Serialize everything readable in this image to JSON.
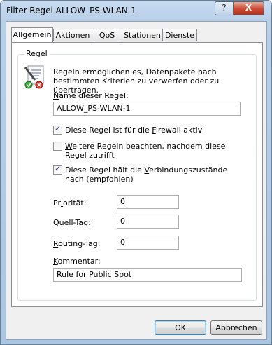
{
  "window": {
    "title": "Filter-Regel ALLOW_PS-WLAN-1",
    "help_label": "?",
    "close_label": "X"
  },
  "tabs": [
    {
      "label": "Allgemein"
    },
    {
      "label": "Aktionen"
    },
    {
      "label": "QoS"
    },
    {
      "label": "Stationen"
    },
    {
      "label": "Dienste"
    }
  ],
  "group": {
    "label": "Regel"
  },
  "description": "Regeln ermöglichen es, Datenpakete nach bestimmten Kriterien zu verwerfen oder zu übertragen.",
  "fields": {
    "rule_name": {
      "label_u": "N",
      "label_rest": "ame dieser Regel:",
      "value": "ALLOW_PS-WLAN-1"
    },
    "priority": {
      "label_u": "",
      "label_pre": "Pr",
      "label_u2": "i",
      "label_rest": "orität:",
      "value": "0"
    },
    "source_tag": {
      "label_u": "Q",
      "label_rest": "uell-Tag:",
      "value": "0"
    },
    "routing_tag": {
      "label_u": "R",
      "label_rest": "outing-Tag:",
      "value": "0"
    },
    "comment": {
      "label_u": "K",
      "label_rest": "ommentar:",
      "value": "Rule for Public Spot"
    }
  },
  "checkboxes": [
    {
      "label_pre": "Diese Regel ist für die ",
      "label_u": "F",
      "label_rest": "irewall aktiv",
      "checked": true
    },
    {
      "label_pre": "",
      "label_u": "W",
      "label_rest": "eitere Regeln beachten, nachdem diese Regel zutrifft",
      "checked": false
    },
    {
      "label_pre": "Diese Regel hält die ",
      "label_u": "V",
      "label_rest": "erbindungszustände nach (empfohlen)",
      "checked": true
    }
  ],
  "buttons": {
    "ok": "OK",
    "cancel": "Abbrechen"
  }
}
